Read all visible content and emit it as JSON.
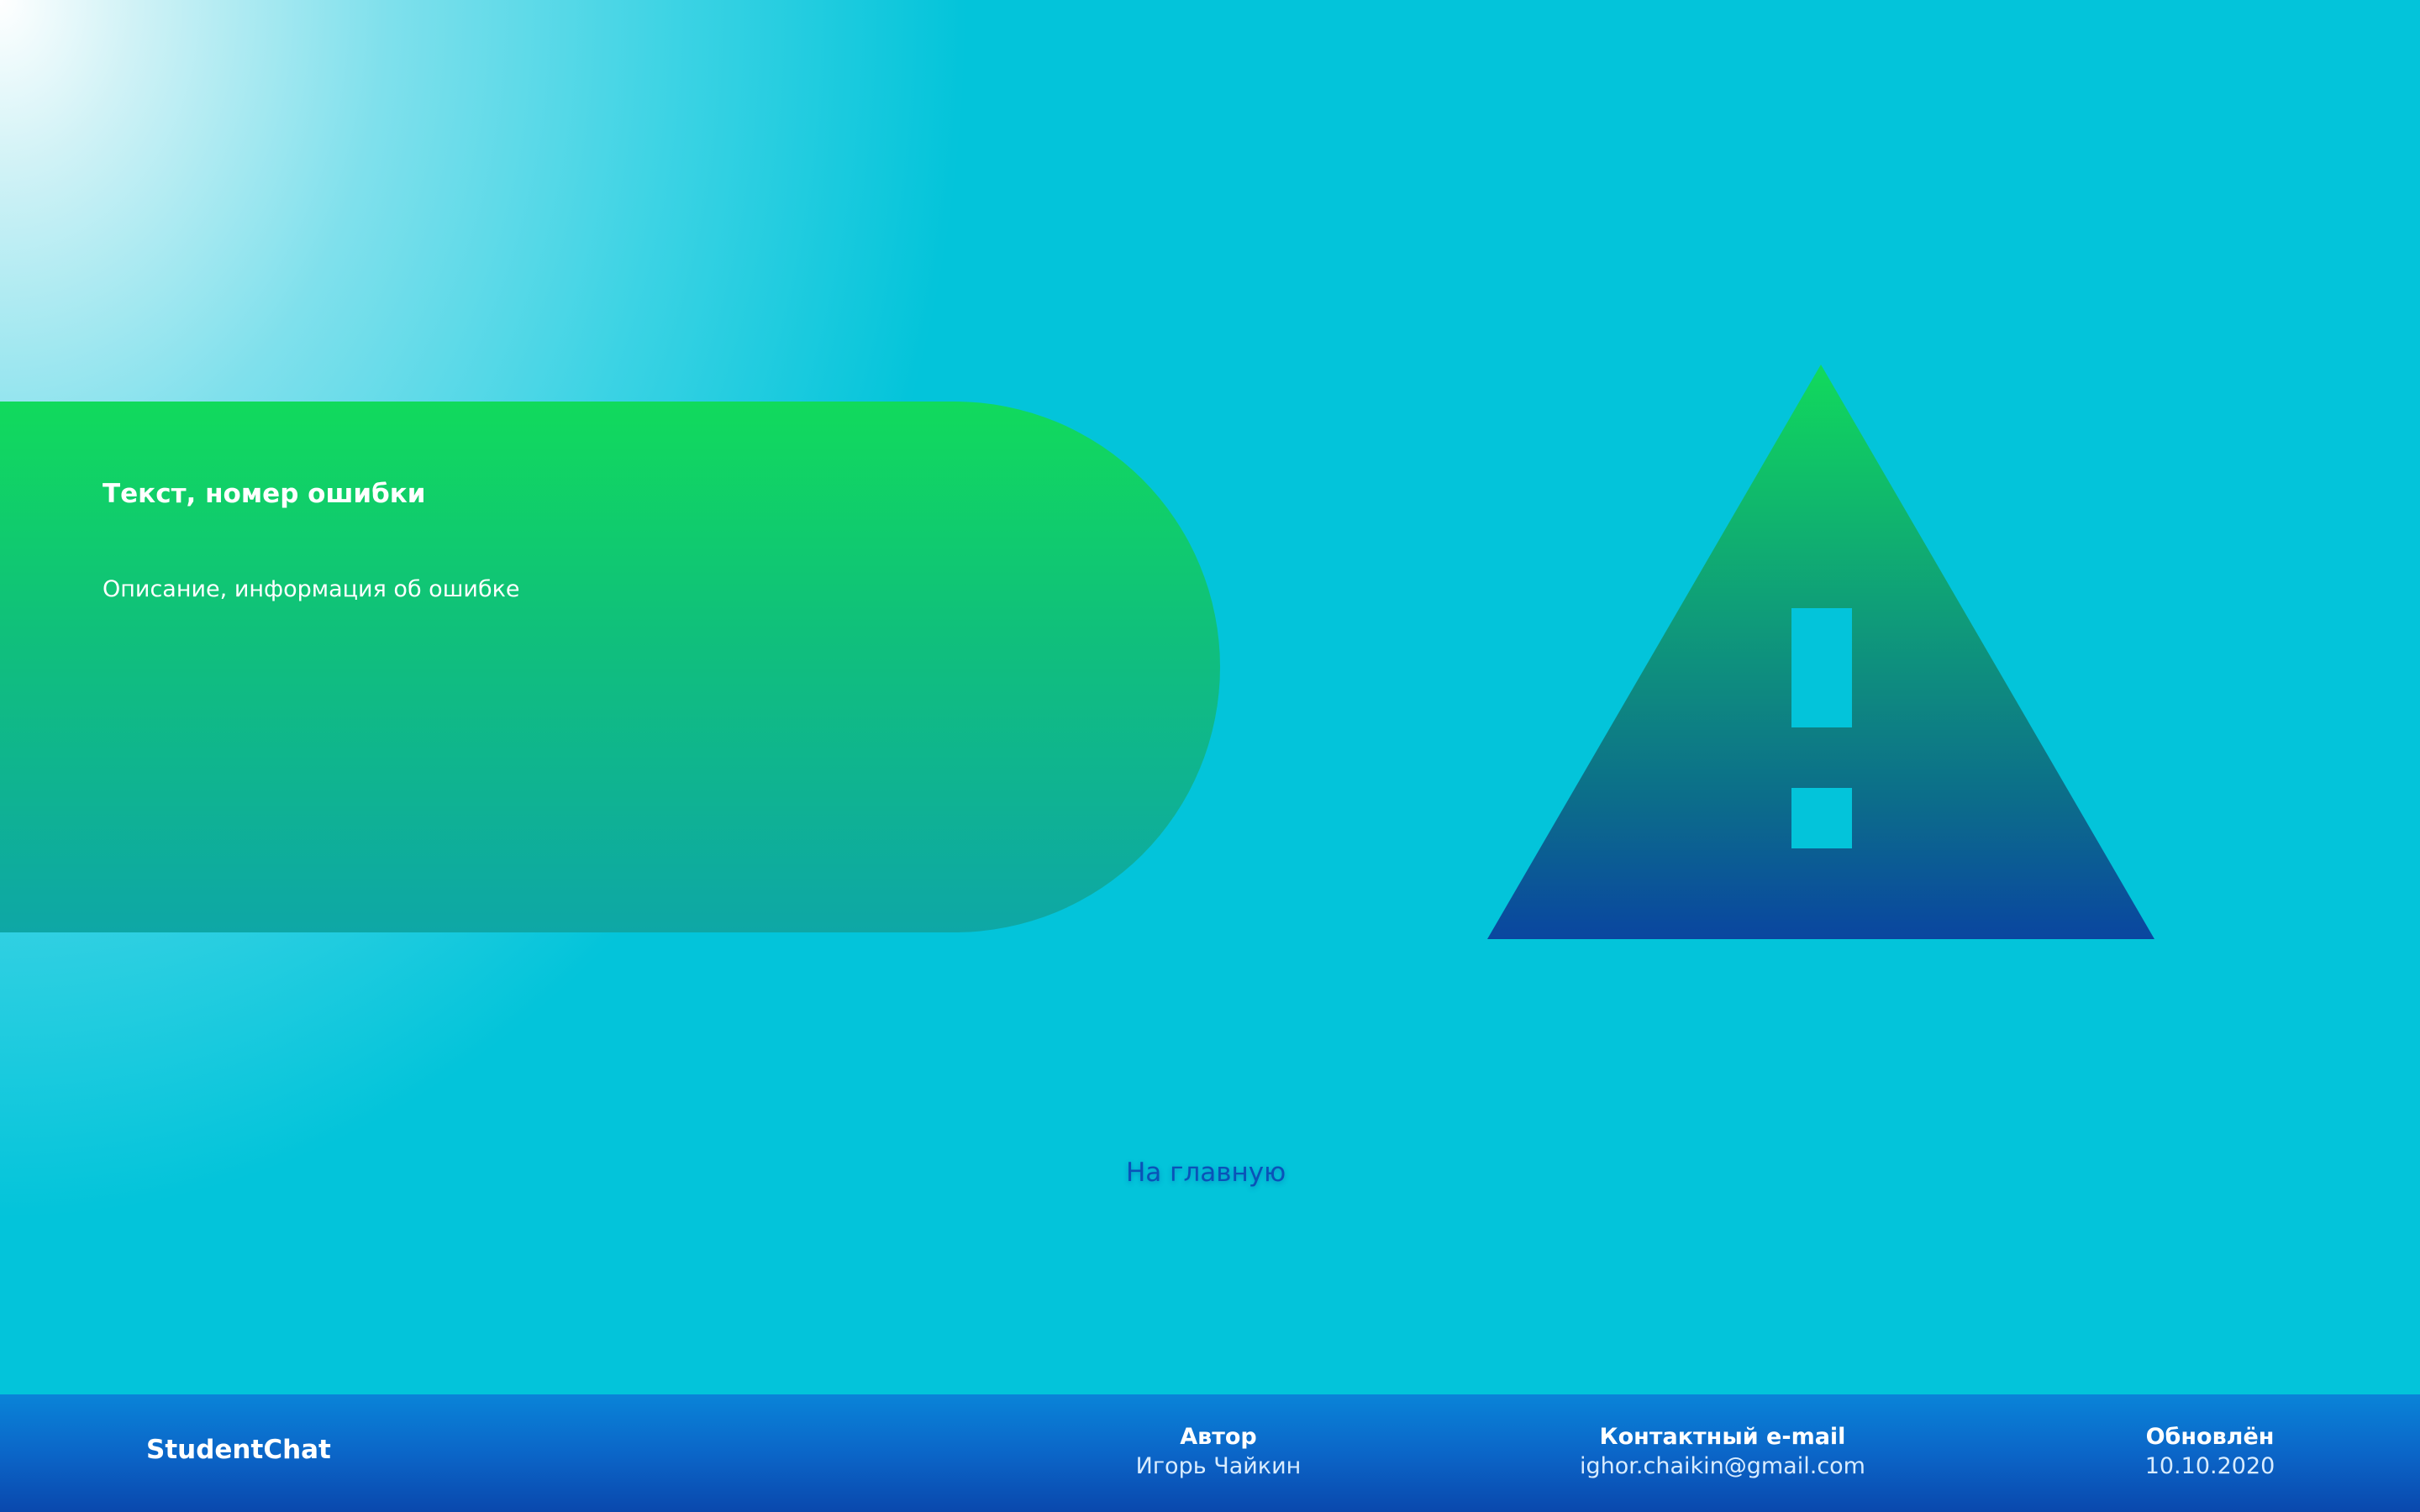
{
  "error": {
    "title": "Текст, номер ошибки",
    "description": "Описание, информация об ошибке"
  },
  "icons": {
    "warning": "warning-triangle-icon"
  },
  "home_link": {
    "label": "На главную"
  },
  "footer": {
    "brand": "StudentChat",
    "author_label": "Автор",
    "author_value": "Игорь Чайкин",
    "email_label": "Контактный e-mail",
    "email_value": "ighor.chaikin@gmail.com",
    "updated_label": "Обновлён",
    "updated_value": "10.10.2020"
  },
  "colors": {
    "background": "#03c4da",
    "card_top": "#11da5c",
    "card_bottom": "#0ea7a6",
    "icon_top": "#11da5c",
    "icon_bottom": "#0a46a0",
    "link": "#0a52b8",
    "footer": "#0a66c8"
  }
}
